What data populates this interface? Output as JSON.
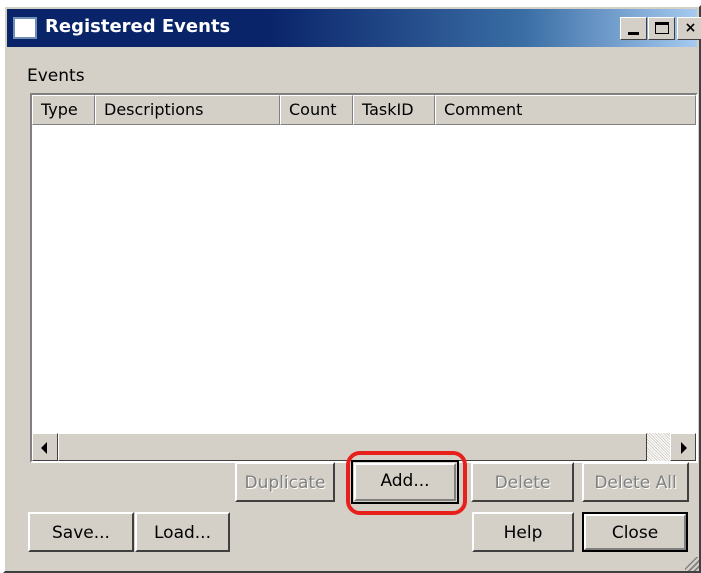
{
  "window": {
    "title": "Registered Events"
  },
  "titlebar_buttons": {
    "minimize_icon": "minimize-icon",
    "maximize_icon": "maximize-icon",
    "close_label": "×"
  },
  "events": {
    "label": "Events",
    "columns": [
      "Type",
      "Descriptions",
      "Count",
      "TaskID",
      "Comment"
    ],
    "rows": []
  },
  "buttons": {
    "duplicate": "Duplicate",
    "add": "Add...",
    "delete": "Delete",
    "delete_all": "Delete All",
    "save": "Save...",
    "load": "Load...",
    "help": "Help",
    "close": "Close"
  },
  "button_states": {
    "duplicate_enabled": false,
    "delete_enabled": false,
    "delete_all_enabled": false
  },
  "highlight": {
    "target": "add",
    "color": "#e8201c"
  },
  "colors": {
    "titlebar_start": "#0a246a",
    "titlebar_end": "#a6caf0",
    "face": "#d4d0c8"
  }
}
